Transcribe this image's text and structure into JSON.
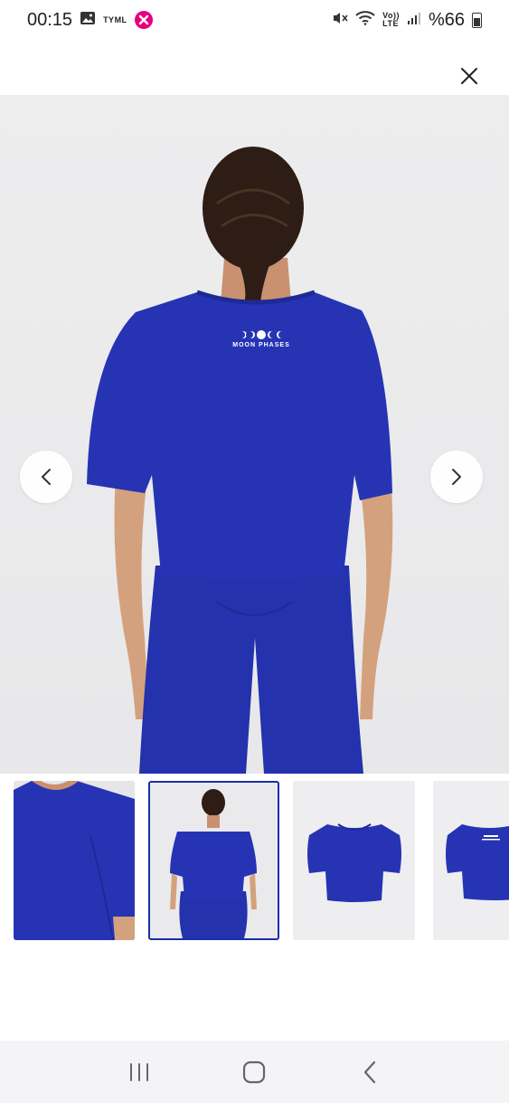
{
  "status_bar": {
    "time": "00:15",
    "carrier_label": "TYML",
    "network_label_top": "Vo))",
    "network_label_bottom": "LTE",
    "battery": "%66"
  },
  "gallery": {
    "print_text": "MOON PHASES",
    "thumbnails": [
      {
        "view": "shoulder-closeup",
        "selected": false
      },
      {
        "view": "back-model",
        "selected": true
      },
      {
        "view": "flat-front",
        "selected": false
      },
      {
        "view": "flat-back",
        "selected": false
      }
    ]
  },
  "icons": {
    "close": "close-icon",
    "prev": "chevron-left-icon",
    "next": "chevron-right-icon",
    "recent": "recent-apps-icon",
    "home": "home-icon",
    "back": "back-icon"
  },
  "colors": {
    "garment_blue": "#2634b4",
    "selected_border": "#1a2fa8",
    "badge_pink": "#e6007e"
  }
}
